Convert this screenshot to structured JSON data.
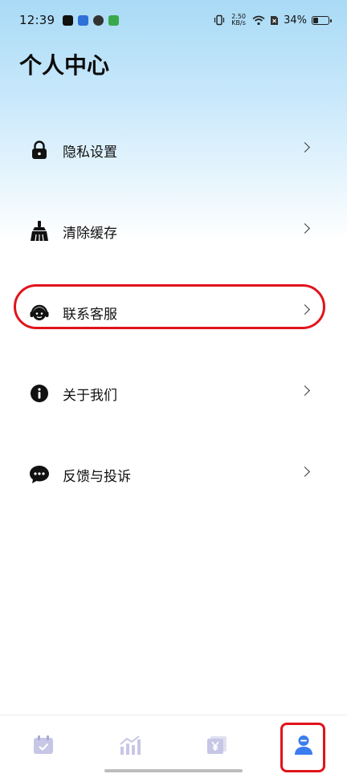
{
  "status_bar": {
    "time": "12:39",
    "net_speed_value": "2.50",
    "net_speed_unit": "KB/s",
    "battery_text": "34%",
    "battery_level": 0.34
  },
  "page": {
    "title": "个人中心"
  },
  "menu": {
    "items": [
      {
        "label": "隐私设置",
        "icon": "lock-icon"
      },
      {
        "label": "清除缓存",
        "icon": "broom-icon"
      },
      {
        "label": "联系客服",
        "icon": "headset-icon"
      },
      {
        "label": "关于我们",
        "icon": "info-icon"
      },
      {
        "label": "反馈与投诉",
        "icon": "chat-bubble-icon"
      }
    ]
  },
  "tab_bar": {
    "tabs": [
      {
        "icon": "calendar-check-icon",
        "active": false
      },
      {
        "icon": "bar-chart-icon",
        "active": false
      },
      {
        "icon": "yuan-wallet-icon",
        "active": false
      },
      {
        "icon": "user-icon",
        "active": true
      }
    ],
    "active_color": "#3b7cf0",
    "inactive_color": "#c7c6e6"
  },
  "colors": {
    "highlight": "#e0141c"
  }
}
